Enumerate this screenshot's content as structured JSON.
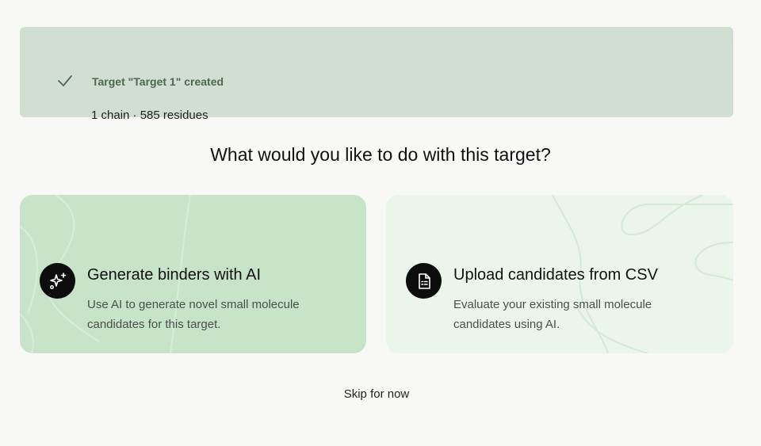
{
  "banner": {
    "title": "Target \"Target 1\" created",
    "subtitle": "1 chain · 585 residues"
  },
  "question": "What would you like to do with this target?",
  "cards": [
    {
      "title": "Generate binders with AI",
      "description": "Use AI to generate novel small molecule candidates for this target.",
      "icon": "sparkles-icon"
    },
    {
      "title": "Upload candidates from CSV",
      "description": "Evaluate your existing small molecule candidates using AI.",
      "icon": "file-spreadsheet-icon"
    }
  ],
  "skip_label": "Skip for now",
  "colors": {
    "banner_bg": "#d1dfd2",
    "banner_title": "#4b6a4d",
    "card_ai_bg": "#c7e4c8",
    "card_csv_bg": "#ebf5ec",
    "icon_bg": "#0d0d0d"
  }
}
